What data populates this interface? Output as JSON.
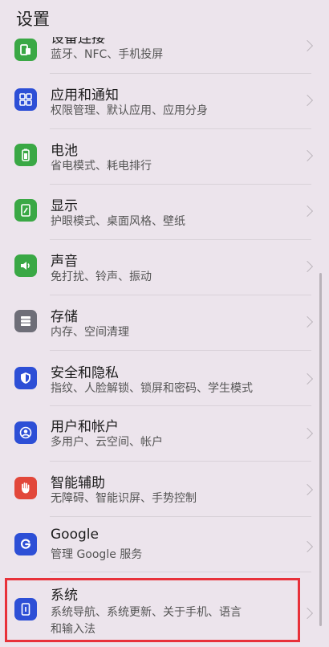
{
  "header": {
    "title": "设置"
  },
  "items": [
    {
      "key": "device-connection",
      "title": "设备连接",
      "subtitle": "蓝牙、NFC、手机投屏",
      "icon": "device-connection-icon",
      "color": "#3aa845"
    },
    {
      "key": "apps-notifications",
      "title": "应用和通知",
      "subtitle": "权限管理、默认应用、应用分身",
      "icon": "apps-grid-icon",
      "color": "#2d4fd6"
    },
    {
      "key": "battery",
      "title": "电池",
      "subtitle": "省电模式、耗电排行",
      "icon": "battery-icon",
      "color": "#3aa845"
    },
    {
      "key": "display",
      "title": "显示",
      "subtitle": "护眼模式、桌面风格、壁纸",
      "icon": "display-icon",
      "color": "#3aa845"
    },
    {
      "key": "sound",
      "title": "声音",
      "subtitle": "免打扰、铃声、振动",
      "icon": "speaker-icon",
      "color": "#3aa845"
    },
    {
      "key": "storage",
      "title": "存储",
      "subtitle": "内存、空间清理",
      "icon": "storage-icon",
      "color": "#6e6e78"
    },
    {
      "key": "security-privacy",
      "title": "安全和隐私",
      "subtitle": "指纹、人脸解锁、锁屏和密码、学生模式",
      "icon": "shield-icon",
      "color": "#2d4fd6"
    },
    {
      "key": "users-accounts",
      "title": "用户和帐户",
      "subtitle": "多用户、云空间、帐户",
      "icon": "user-icon",
      "color": "#2d4fd6"
    },
    {
      "key": "accessibility",
      "title": "智能辅助",
      "subtitle": "无障碍、智能识屏、手势控制",
      "icon": "hand-icon",
      "color": "#e2473a"
    },
    {
      "key": "google",
      "title": "Google",
      "subtitle": "管理 Google 服务",
      "icon": "google-icon",
      "color": "#2d4fd6"
    },
    {
      "key": "system",
      "title": "系统",
      "subtitle": "系统导航、系统更新、关于手机、语言",
      "subtitle2": "和输入法",
      "icon": "phone-info-icon",
      "color": "#2d4fd6"
    }
  ]
}
